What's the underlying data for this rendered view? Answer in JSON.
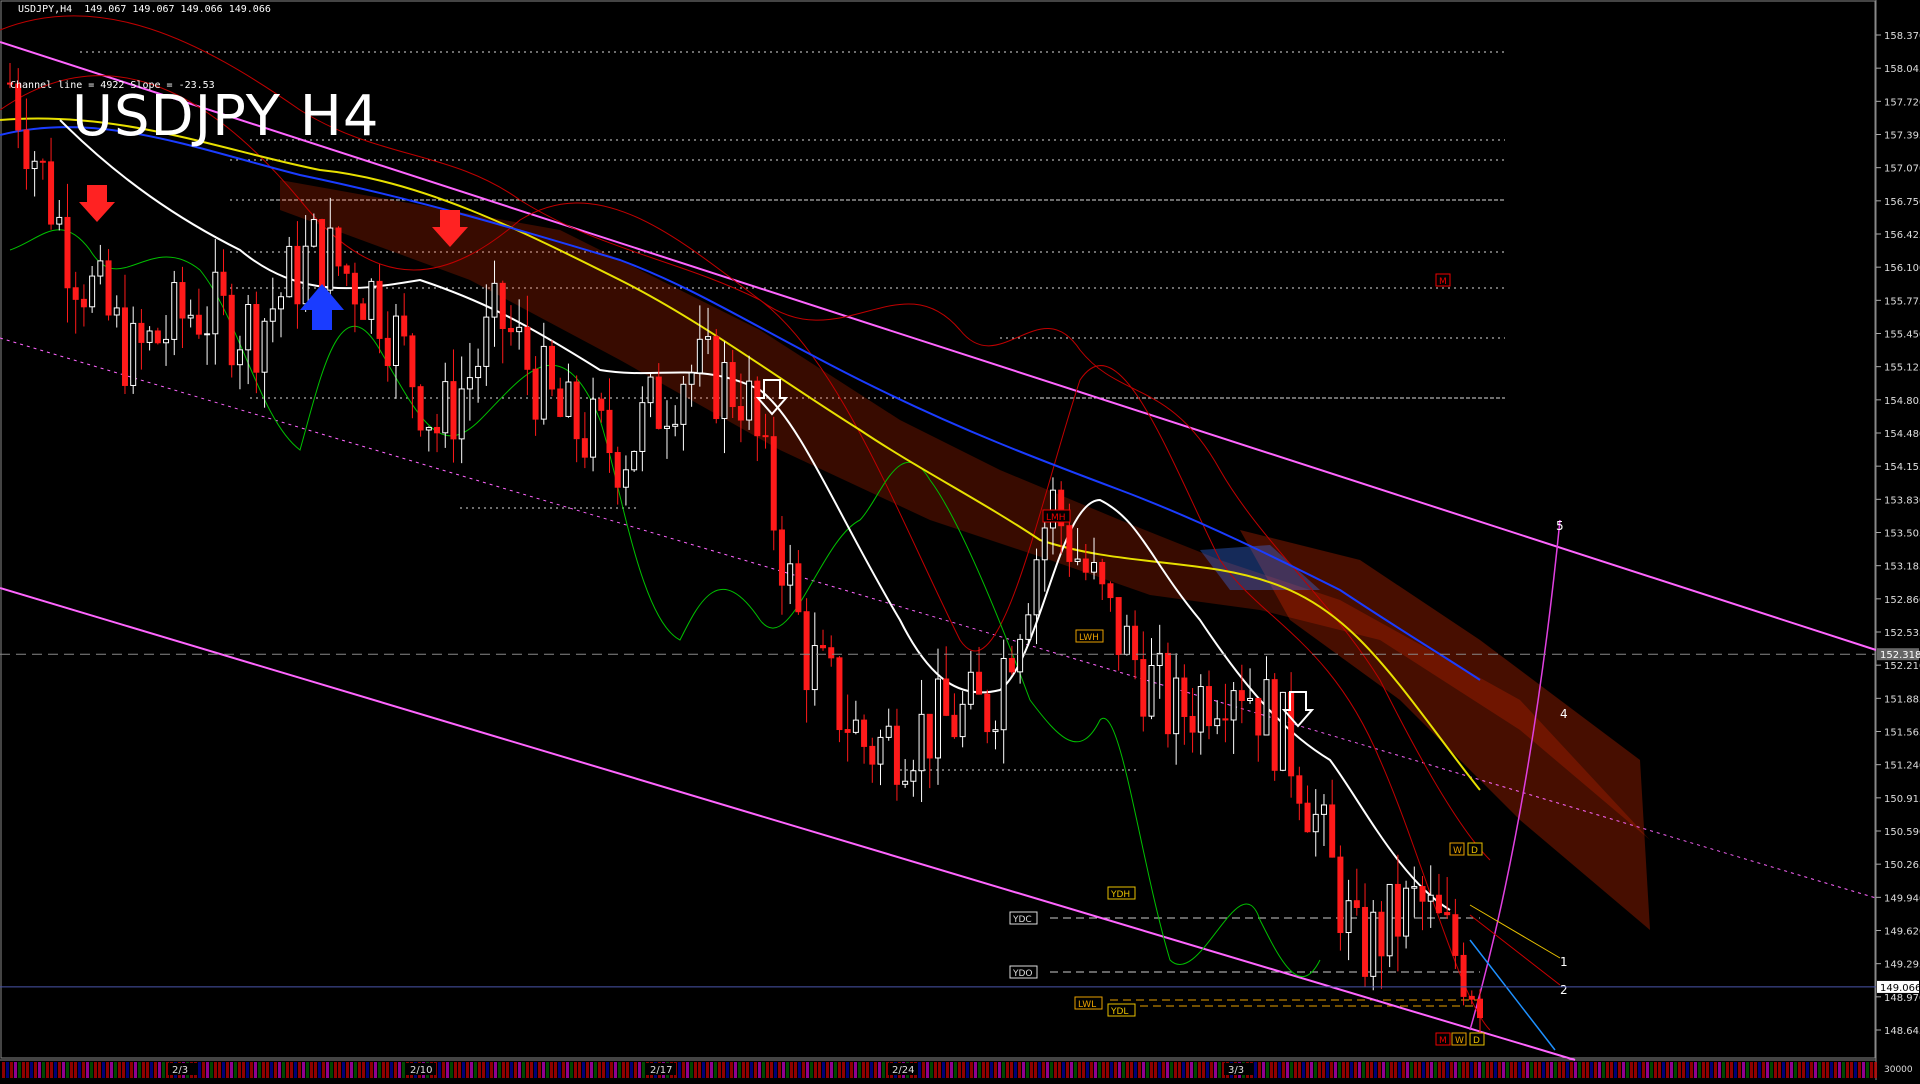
{
  "header": {
    "symbol_line": "USDJPY,H4  149.067 149.067 149.066 149.066",
    "channel_info": "Channel line = 4922 Slope = -23.53",
    "title": "USDJPY H4"
  },
  "colors": {
    "background": "#000000",
    "bull_candle": "#ffffff",
    "bear_candle": "#ff1a1a",
    "ma_white": "#ffffff",
    "ma_yellow": "#e8e000",
    "ma_blue": "#1a3cff",
    "bollinger": "#c00000",
    "chikou_green": "#00c000",
    "channel": "#ff66ff",
    "ichimoku_cloud": "#ff3300",
    "ichimoku_blue_cloud": "#3c78ff",
    "level_line": "#cccccc",
    "orange_level": "#e8a000"
  },
  "price_axis": {
    "labels": [
      "158.370",
      "158.045",
      "157.720",
      "157.395",
      "157.070",
      "156.750",
      "156.425",
      "156.100",
      "155.775",
      "155.450",
      "155.125",
      "154.805",
      "154.480",
      "154.155",
      "153.830",
      "153.505",
      "153.185",
      "152.860",
      "152.535",
      "152.210",
      "151.885",
      "151.565",
      "151.240",
      "150.915",
      "150.590",
      "150.265",
      "149.940",
      "149.620",
      "149.295",
      "148.970",
      "148.645"
    ],
    "current_price_tag": "149.066",
    "dashed_level_tag": "152.318",
    "bottom_tag": "30000"
  },
  "time_axis": {
    "labels": [
      "2/3",
      "2/10",
      "2/17",
      "2/24",
      "3/3"
    ]
  },
  "level_tags": {
    "ydh": "YDH",
    "ydc": "YDC",
    "ydo": "YDO",
    "lwl": "LWL",
    "ydl": "YDL",
    "lwh": "LWH",
    "lmh": "LMH",
    "m_top": "M",
    "wd_top_w": "W",
    "wd_top_d": "D",
    "mwd_m": "M",
    "mwd_w": "W",
    "mwd_d": "D"
  },
  "wave_labels": [
    "1",
    "2",
    "4",
    "5"
  ],
  "chart_data": {
    "type": "candlestick",
    "title": "USDJPY H4",
    "xlabel": "",
    "ylabel": "",
    "ylim": [
      148.45,
      158.55
    ],
    "dates": [
      "2/3",
      "2/10",
      "2/17",
      "2/24",
      "3/3"
    ],
    "last_price": 149.066,
    "approx_path": [
      {
        "x": "1/31",
        "y": 157.9
      },
      {
        "x": "2/3",
        "y": 156.2
      },
      {
        "x": "2/4",
        "y": 155.2
      },
      {
        "x": "2/5",
        "y": 155.7
      },
      {
        "x": "2/6",
        "y": 155.5
      },
      {
        "x": "2/7",
        "y": 156.3
      },
      {
        "x": "2/10",
        "y": 155.8
      },
      {
        "x": "2/11",
        "y": 154.5
      },
      {
        "x": "2/12",
        "y": 155.6
      },
      {
        "x": "2/13",
        "y": 154.6
      },
      {
        "x": "2/14",
        "y": 154.3
      },
      {
        "x": "2/17",
        "y": 155.1
      },
      {
        "x": "2/18",
        "y": 154.9
      },
      {
        "x": "2/19",
        "y": 152.3
      },
      {
        "x": "2/20",
        "y": 151.4
      },
      {
        "x": "2/21",
        "y": 151.6
      },
      {
        "x": "2/24",
        "y": 151.8
      },
      {
        "x": "2/25",
        "y": 153.8
      },
      {
        "x": "2/26",
        "y": 152.6
      },
      {
        "x": "2/27",
        "y": 151.7
      },
      {
        "x": "2/28",
        "y": 152.2
      },
      {
        "x": "3/3",
        "y": 151.3
      },
      {
        "x": "3/4",
        "y": 149.4
      },
      {
        "x": "3/5",
        "y": 149.9
      },
      {
        "x": "3/6",
        "y": 149.066
      }
    ],
    "grid": false,
    "legend": "none"
  }
}
